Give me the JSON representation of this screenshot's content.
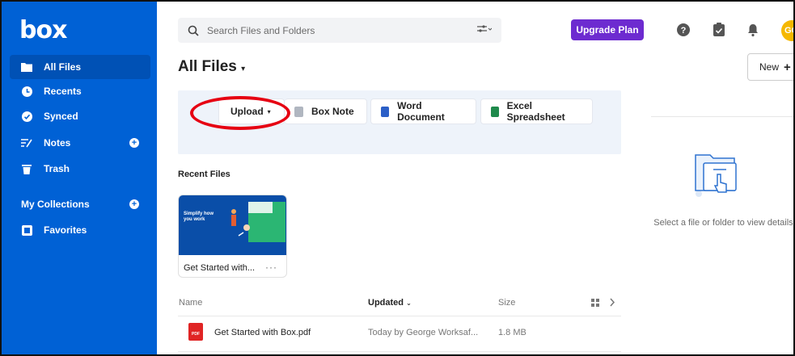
{
  "brand": {
    "logo": "box"
  },
  "sidebar": {
    "items": [
      {
        "label": "All Files",
        "icon": "folder-icon"
      },
      {
        "label": "Recents",
        "icon": "clock-icon"
      },
      {
        "label": "Synced",
        "icon": "check-circle-icon"
      },
      {
        "label": "Notes",
        "icon": "notes-icon"
      },
      {
        "label": "Trash",
        "icon": "trash-icon"
      }
    ],
    "collections_label": "My Collections",
    "favorites_label": "Favorites"
  },
  "search": {
    "placeholder": "Search Files and Folders"
  },
  "header": {
    "upgrade_label": "Upgrade Plan",
    "avatar_initials": "GO"
  },
  "main": {
    "title": "All Files",
    "new_label": "New",
    "create": [
      {
        "label": "Upload"
      },
      {
        "label": "Box Note"
      },
      {
        "label": "Word Document"
      },
      {
        "label": "Excel Spreadsheet"
      }
    ],
    "recent_label": "Recent Files",
    "recent_cards": [
      {
        "name": "Get Started with...",
        "thumb_title": "Simplify how you work"
      }
    ],
    "table": {
      "columns": [
        "Name",
        "Updated",
        "Size"
      ],
      "rows": [
        {
          "name": "Get Started with Box.pdf",
          "updated": "Today by George Worksaf...",
          "size": "1.8 MB",
          "icon_text": "PDF"
        }
      ]
    }
  },
  "details": {
    "empty_text": "Select a file or folder to view details."
  },
  "colors": {
    "sidebar": "#0061d5",
    "upgrade": "#6d2bd0",
    "annotation": "#e60012"
  }
}
